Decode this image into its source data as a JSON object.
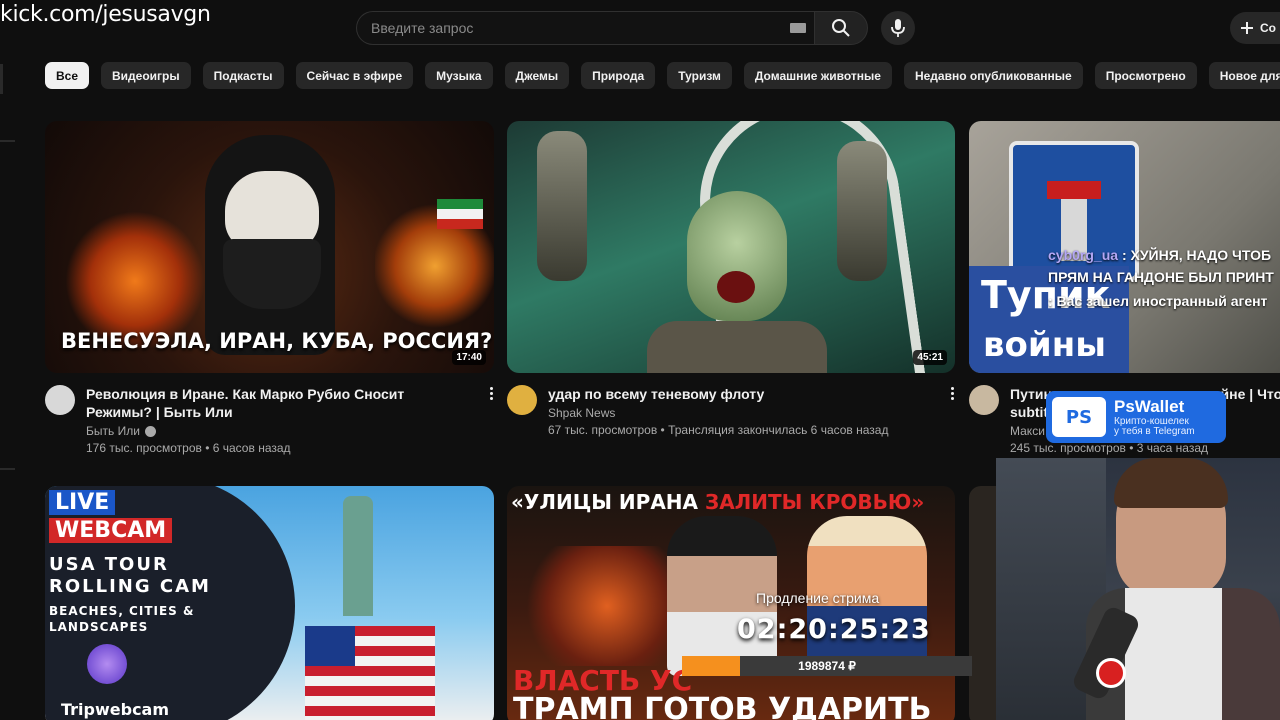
{
  "overlay": {
    "stream_url": "kick.com/jesusavgn"
  },
  "topbar": {
    "search_placeholder": "Введите запрос",
    "create_label": "Со"
  },
  "chips": [
    "Все",
    "Видеоигры",
    "Подкасты",
    "Сейчас в эфире",
    "Музыка",
    "Джемы",
    "Природа",
    "Туризм",
    "Домашние животные",
    "Недавно опубликованные",
    "Просмотрено",
    "Новое для вас"
  ],
  "videos": [
    {
      "title": "Революция в Иране. Как Марко Рубио Сносит Режимы? | Быть Или",
      "channel": "Быть Или",
      "stats": "176 тыс. просмотров • 6 часов назад",
      "duration": "17:40",
      "thumb_text": "ВЕНЕСУЭЛА, ИРАН, КУБА, РОССИЯ?"
    },
    {
      "title": "удар по всему теневому флоту",
      "channel": "Shpak News",
      "stats": "67 тыс. просмотров • Трансляция закончилась 6 часов назад",
      "duration": "45:21"
    },
    {
      "title": "Путин перестал говорить о войне | Что случ",
      "title2": "subtit",
      "channel": "Макси",
      "stats": "245 тыс. просмотров • 3 часа назад",
      "thumb_text_1": "Тупик",
      "thumb_text_2": "войны"
    },
    {
      "thumb_live": "LIVE",
      "thumb_webcam": "WEBCAM",
      "thumb_line1": "USA TOUR",
      "thumb_line2": "ROLLING CAM",
      "thumb_line3": "BEACHES, CITIES &",
      "thumb_line4": "LANDSCAPES",
      "thumb_brand": "Tripwebcam"
    },
    {
      "thumb_head_1": "«УЛИЦЫ ИРАНА ",
      "thumb_head_2": "ЗАЛИТЫ КРОВЬЮ»",
      "thumb_bottom_1": "ВЛАСТЬ УС",
      "thumb_bottom_2": "ТРАМП ГОТОВ УДАРИТЬ"
    }
  ],
  "chat": [
    {
      "user": "cyb0rg_ua",
      "text": ": ХУЙНЯ, НАДО ЧТОБ ПРЯМ НА ГАНДОНЕ БЫЛ ПРИНТ"
    },
    {
      "user": "",
      "text": ": Вас зашел иностранный агент"
    }
  ],
  "ad": {
    "logo": "PS",
    "name": "PsWallet",
    "sub1": "Крипто-кошелек",
    "sub2": "у тебя в Telegram"
  },
  "stream": {
    "extend_label": "Продление стрима",
    "timer": "02:20:25:23",
    "donation": "1989874 ₽",
    "donation_progress": 0.2
  },
  "colors": {
    "background": "#0f0f0f",
    "chip": "#272727",
    "chip_active": "#f1f1f1",
    "secondary_text": "#aaaaaa",
    "progress": "#f5901e",
    "ad": "#1f6ae0"
  }
}
